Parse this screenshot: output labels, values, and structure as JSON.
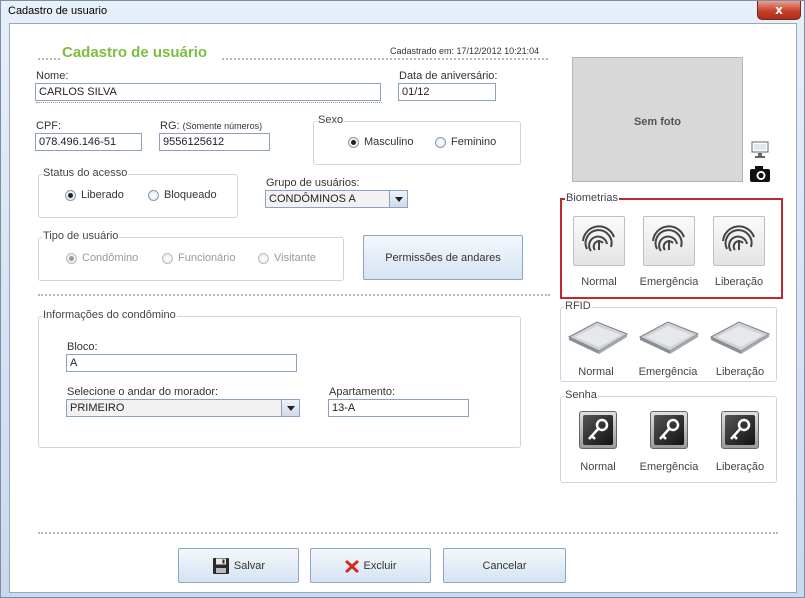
{
  "window": {
    "title": "Cadastro de usuario",
    "close_glyph": "x"
  },
  "header": {
    "title": "Cadastro de usuário",
    "created": "Cadastrado em: 17/12/2012 10:21:04"
  },
  "fields": {
    "nome_label": "Nome:",
    "nome_value": "CARLOS SILVA",
    "aniversario_label": "Data de aniversário:",
    "aniversario_value": "01/12",
    "cpf_label": "CPF:",
    "cpf_value": "078.496.146-51",
    "rg_label": "RG:",
    "rg_note": "(Somente números)",
    "rg_value": "9556125612"
  },
  "sexo": {
    "legend": "Sexo",
    "options": [
      "Masculino",
      "Feminino"
    ],
    "selected": "Masculino"
  },
  "status": {
    "legend": "Status do acesso",
    "options": [
      "Liberado",
      "Bloqueado"
    ],
    "selected": "Liberado"
  },
  "grupo": {
    "label": "Grupo de usuários:",
    "value": "CONDÔMINOS A"
  },
  "tipo": {
    "legend": "Tipo de usuário",
    "options": [
      "Condômino",
      "Funcionário",
      "Visitante"
    ],
    "selected": "Condômino"
  },
  "permissoes_button": "Permissões de andares",
  "condominio": {
    "legend": "Informações do condômino",
    "bloco_label": "Bloco:",
    "bloco_value": "A",
    "andar_label": "Selecione o andar do morador:",
    "andar_value": "PRIMEIRO",
    "apartamento_label": "Apartamento:",
    "apartamento_value": "13-A"
  },
  "photo": {
    "placeholder": "Sem foto"
  },
  "biometrias": {
    "legend": "Biometrias",
    "items": [
      "Normal",
      "Emergência",
      "Liberação"
    ],
    "highlight_color": "#c0282d"
  },
  "rfid": {
    "legend": "RFID",
    "items": [
      "Normal",
      "Emergência",
      "Liberação"
    ]
  },
  "senha": {
    "legend": "Senha",
    "items": [
      "Normal",
      "Emergência",
      "Liberação"
    ]
  },
  "footer": {
    "save": "Salvar",
    "delete": "Excluir",
    "cancel": "Cancelar"
  },
  "icons": [
    "close-icon",
    "monitor-icon",
    "camera-icon",
    "fingerprint-icon",
    "rfid-card-icon",
    "key-icon",
    "floppy-disk-icon",
    "red-x-icon"
  ]
}
